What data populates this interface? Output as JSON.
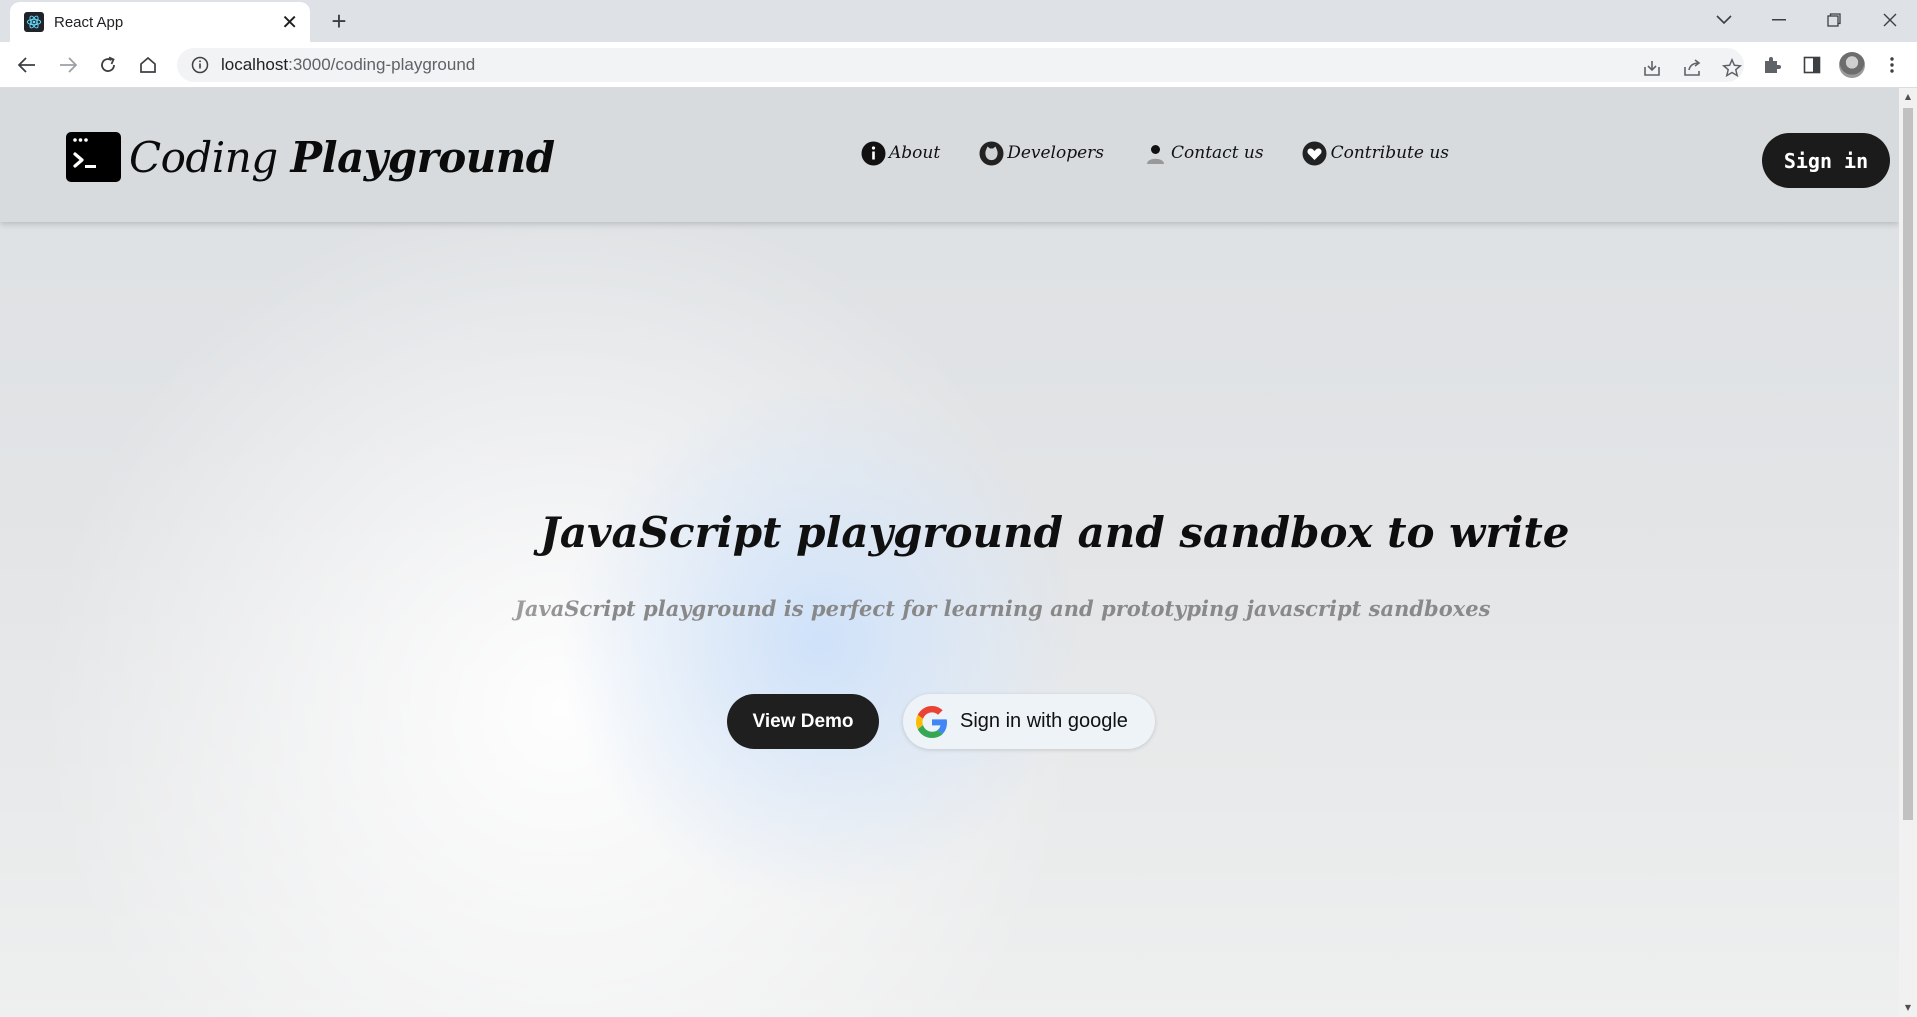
{
  "browser": {
    "tab_title": "React App",
    "new_tab_label": "+",
    "url_host": "localhost",
    "url_path": ":3000/coding-playground"
  },
  "site": {
    "brand_prefix": "Coding",
    "brand_bold": "Playground",
    "nav": [
      {
        "label": "About",
        "icon": "info-icon"
      },
      {
        "label": "Developers",
        "icon": "github-icon"
      },
      {
        "label": "Contact us",
        "icon": "person-icon"
      },
      {
        "label": "Contribute us",
        "icon": "heart-icon"
      }
    ],
    "signin_label": "Sign in"
  },
  "hero": {
    "title": "JavaScript playground and sandbox to write",
    "subtitle": "JavaScript playground is perfect for learning and prototyping javascript sandboxes",
    "demo_button": "View Demo",
    "google_button": "Sign in with google"
  },
  "colors": {
    "dark_button": "#1f1f1f",
    "header_bg": "#d6dadd",
    "accent_glow": "#cde1fa"
  }
}
